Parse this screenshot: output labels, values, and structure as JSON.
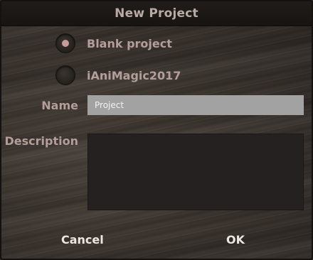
{
  "dialog": {
    "title": "New Project"
  },
  "project_type": {
    "options": [
      {
        "label": "Blank project",
        "selected": true
      },
      {
        "label": "iAniMagic2017",
        "selected": false
      }
    ]
  },
  "form": {
    "name_label": "Name",
    "name_value": "Project",
    "description_label": "Description",
    "description_value": ""
  },
  "buttons": {
    "cancel_label": "Cancel",
    "ok_label": "OK"
  },
  "colors": {
    "label_text": "#b49e9a",
    "selected_dot": "#c89a98",
    "button_text": "#ece7e4",
    "name_field_bg": "#a2a2a2",
    "description_field_bg": "#242120"
  }
}
